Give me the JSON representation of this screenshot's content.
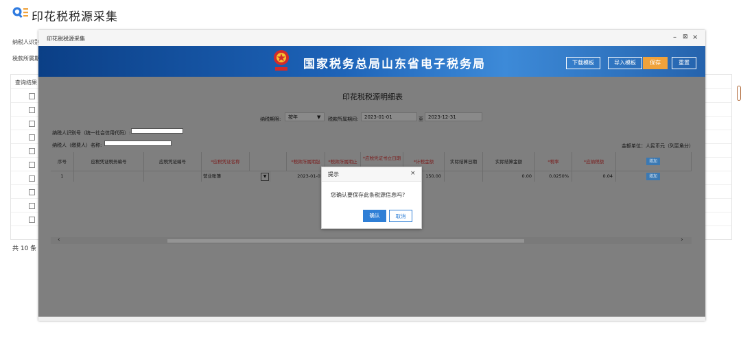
{
  "page": {
    "title": "印花税税源采集",
    "taxpayer_id_label": "纳税人识别",
    "tax_period_label": "税款所属期",
    "query_result_label": "查询结果",
    "total_text": "共 10 条"
  },
  "window": {
    "title": "印花税税源采集",
    "minimize": "–",
    "maximize": "⊠",
    "close": "×"
  },
  "banner": {
    "title": "国家税务总局山东省电子税务局",
    "buttons": [
      "下载模板",
      "导入模板",
      "保存",
      "重置"
    ],
    "colors": {
      "save": "#f0a23b",
      "primary": "#1d63b8"
    }
  },
  "form": {
    "title": "印花税税源明细表",
    "period_label": "纳税期限:",
    "period_value": "按年",
    "belong_label": "税款所属期间:",
    "date_from": "2023-01-01",
    "to_label": "至",
    "date_to": "2023-12-31",
    "taxpayer_code_label": "纳税人识别号（统一社会信用代码）:",
    "taxpayer_name_label": "纳税人（缴费人）名称:",
    "unit_label": "金额单位：人民币元（列至角分）"
  },
  "grid": {
    "headers": [
      "序号",
      "应税凭证税务编号",
      "应税凭证编号",
      "*应税凭证名称",
      "*税款所属期起",
      "*税款所属期止",
      "*应税凭证书立日期",
      "*计税金额",
      "实际结算日期",
      "实际结算金额",
      "*税率",
      "*应纳税额",
      "增加"
    ],
    "row": {
      "no": "1",
      "voucher_name": "营业账簿",
      "period_start": "2023-01-01",
      "tax_amount": "150.00",
      "settle_amount": "0.00",
      "rate": "0.0250%",
      "payable": "0.04",
      "add": "增加"
    }
  },
  "dialog": {
    "title": "提示",
    "close": "×",
    "message": "您确认要保存此条税源信息吗?",
    "confirm": "确认",
    "cancel": "取消"
  }
}
